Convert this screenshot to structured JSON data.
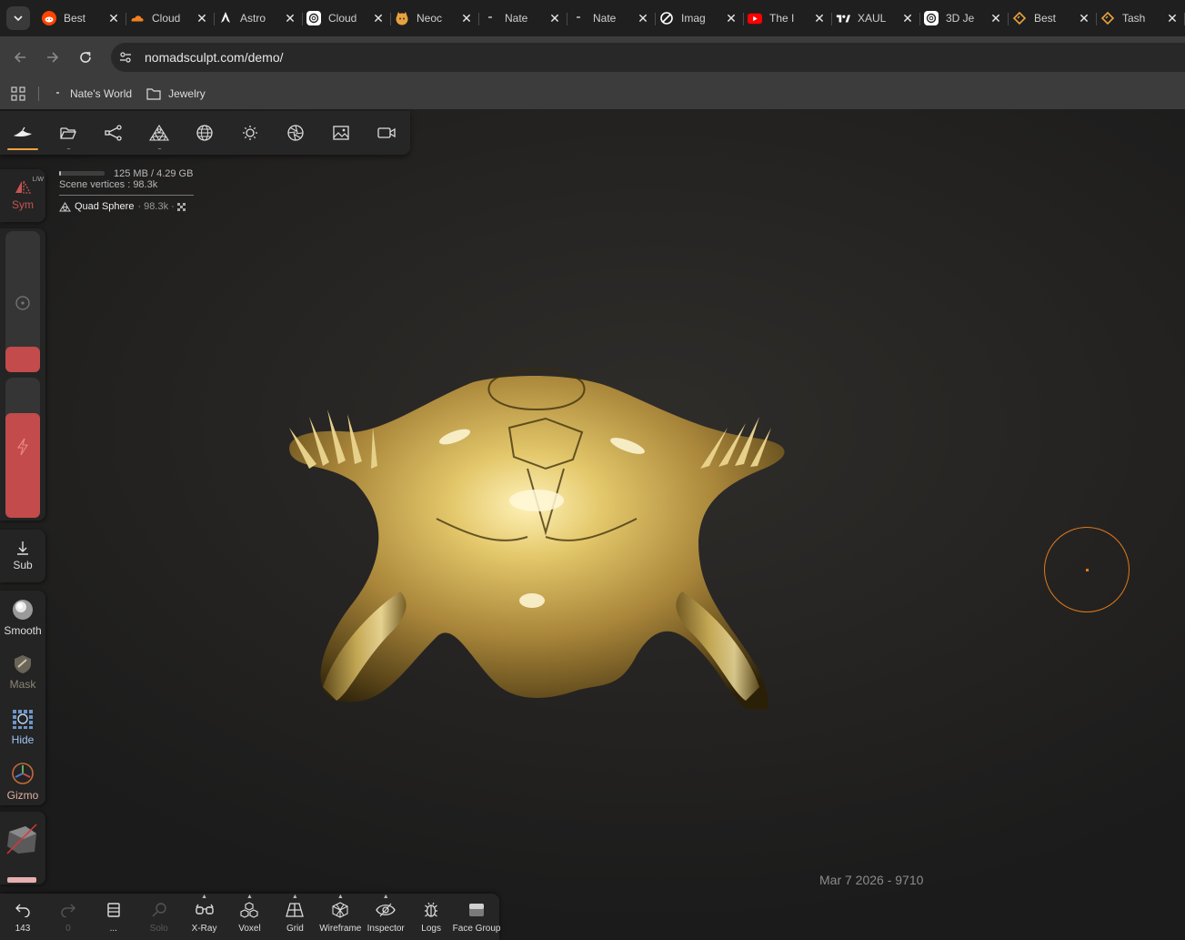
{
  "browser": {
    "tabs": [
      {
        "title": "Best",
        "favicon": "reddit-icon",
        "color": "#ff4500"
      },
      {
        "title": "Cloud",
        "favicon": "cloudflare-icon",
        "color": "#f38020"
      },
      {
        "title": "Astro",
        "favicon": "astro-icon",
        "color": "#ffffff"
      },
      {
        "title": "Cloud",
        "favicon": "openai-icon",
        "color": "#ffffff"
      },
      {
        "title": "Neoc",
        "favicon": "neocities-icon",
        "color": "#e8a33d"
      },
      {
        "title": "Nate",
        "favicon": "page-icon",
        "color": "#888888"
      },
      {
        "title": "Nate",
        "favicon": "page-icon",
        "color": "#888888"
      },
      {
        "title": "Imag",
        "favicon": "image-gen-icon",
        "color": "#ffffff"
      },
      {
        "title": "The I",
        "favicon": "youtube-icon",
        "color": "#ff0000"
      },
      {
        "title": "XAUL",
        "favicon": "tradingview-icon",
        "color": "#ffffff"
      },
      {
        "title": "3D Je",
        "favicon": "openai-icon",
        "color": "#ffffff"
      },
      {
        "title": "Best",
        "favicon": "code-icon",
        "color": "#e8a33d"
      },
      {
        "title": "Tash",
        "favicon": "code-icon",
        "color": "#e8a33d"
      }
    ],
    "url": "nomadsculpt.com/demo/",
    "bookmarks": [
      {
        "label": "Nate's World",
        "icon": "page-icon"
      },
      {
        "label": "Jewelry",
        "icon": "folder-icon"
      }
    ]
  },
  "app": {
    "top_tools": [
      {
        "name": "scene-tool",
        "icon": "nomad-logo-icon",
        "active": true
      },
      {
        "name": "files-tool",
        "icon": "folder-icon",
        "dots": "..."
      },
      {
        "name": "scene-graph-tool",
        "icon": "share-nodes-icon"
      },
      {
        "name": "topology-tool",
        "icon": "mesh-icon",
        "dots": "..."
      },
      {
        "name": "material-tool",
        "icon": "sphere-wire-icon"
      },
      {
        "name": "lighting-tool",
        "icon": "sun-icon"
      },
      {
        "name": "render-tool",
        "icon": "aperture-icon"
      },
      {
        "name": "background-tool",
        "icon": "image-icon"
      },
      {
        "name": "camera-tool",
        "icon": "video-camera-icon"
      }
    ],
    "stats": {
      "memory": "125 MB / 4.29 GB",
      "memory_fraction": 0.03,
      "scene_vertices": "Scene vertices  : 98.3k",
      "mesh_name": "Quad Sphere",
      "mesh_meta": "· 98.3k ·"
    },
    "left_tools": {
      "sym_label": "Sym",
      "sym_badge": "L/W",
      "radius_fraction": 0.18,
      "intensity_fraction": 0.75,
      "sub_label": "Sub",
      "smooth_label": "Smooth",
      "mask_label": "Mask",
      "hide_label": "Hide",
      "gizmo_label": "Gizmo"
    },
    "bottom_tools": [
      {
        "label": "143",
        "icon": "undo-icon",
        "dim": false
      },
      {
        "label": "0",
        "icon": "redo-icon",
        "dim": true
      },
      {
        "label": "...",
        "icon": "layers-icon",
        "dim": false
      },
      {
        "label": "Solo",
        "icon": "search-icon",
        "dim": true
      },
      {
        "label": "X-Ray",
        "icon": "xray-glasses-icon",
        "dim": false,
        "caret": true
      },
      {
        "label": "Voxel",
        "icon": "voxel-icon",
        "dim": false,
        "caret": true
      },
      {
        "label": "Grid",
        "icon": "grid-icon",
        "dim": false,
        "caret": true
      },
      {
        "label": "Wireframe",
        "icon": "wireframe-icon",
        "dim": false,
        "caret": true
      },
      {
        "label": "Inspector",
        "icon": "inspector-icon",
        "dim": false,
        "caret": true
      },
      {
        "label": "Logs",
        "icon": "bug-icon",
        "dim": false
      },
      {
        "label": "Face Group",
        "icon": "face-group-icon",
        "dim": false
      }
    ],
    "date_stamp": "Mar 7 2026 - 9710",
    "colors": {
      "accent": "#f0a040",
      "brush_ring": "#e07a1a",
      "slider_red": "#c34b4b",
      "gold": "#c9a84a"
    }
  }
}
